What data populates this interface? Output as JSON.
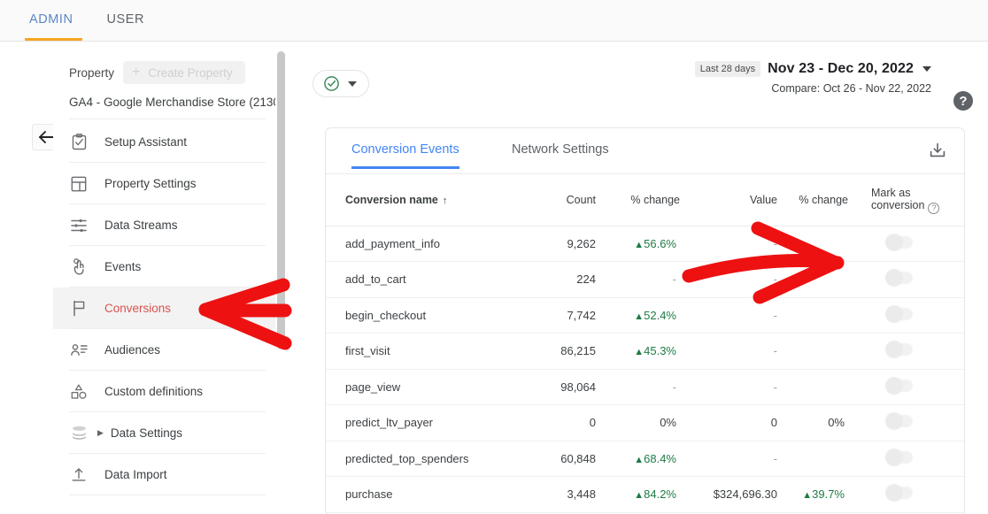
{
  "topbar": {
    "tabs": [
      {
        "label": "ADMIN",
        "active": true
      },
      {
        "label": "USER",
        "active": false
      }
    ]
  },
  "back_button": {
    "icon": "arrow-left-icon"
  },
  "sidebar": {
    "property_label": "Property",
    "create_property_label": "Create Property",
    "property_name": "GA4 - Google Merchandise Store (2130...",
    "items": [
      {
        "label": "Setup Assistant",
        "icon": "clipboard-check-icon",
        "active": false,
        "expandable": false
      },
      {
        "label": "Property Settings",
        "icon": "layout-panel-icon",
        "active": false,
        "expandable": false
      },
      {
        "label": "Data Streams",
        "icon": "sliders-icon",
        "active": false,
        "expandable": false
      },
      {
        "label": "Events",
        "icon": "pointer-hand-icon",
        "active": false,
        "expandable": false
      },
      {
        "label": "Conversions",
        "icon": "flag-icon",
        "active": true,
        "expandable": false
      },
      {
        "label": "Audiences",
        "icon": "person-list-icon",
        "active": false,
        "expandable": false
      },
      {
        "label": "Custom definitions",
        "icon": "shapes-icon",
        "active": false,
        "expandable": false
      },
      {
        "label": "Data Settings",
        "icon": "database-icon",
        "active": false,
        "expandable": true
      },
      {
        "label": "Data Import",
        "icon": "upload-icon",
        "active": false,
        "expandable": false
      }
    ]
  },
  "header": {
    "status_chip_icon": "check-circle-icon",
    "date_pill": "Last 28 days",
    "date_range": "Nov 23 - Dec 20, 2022",
    "compare": "Compare: Oct 26 - Nov 22, 2022",
    "help_icon": "question-mark-icon"
  },
  "card": {
    "tabs": [
      {
        "label": "Conversion Events",
        "active": true
      },
      {
        "label": "Network Settings",
        "active": false
      }
    ],
    "download_icon": "download-icon",
    "columns": {
      "name": "Conversion name",
      "sort_arrow": "↑",
      "count": "Count",
      "count_change": "% change",
      "value": "Value",
      "value_change": "% change",
      "mark": "Mark as conversion",
      "mark_help": "?"
    },
    "rows": [
      {
        "name": "add_payment_info",
        "count": "9,262",
        "count_change": "56.6%",
        "count_dir": "up",
        "value": "-",
        "value_change": "",
        "value_dir": "",
        "toggle": false
      },
      {
        "name": "add_to_cart",
        "count": "224",
        "count_change": "-",
        "count_dir": "none",
        "value": "-",
        "value_change": "",
        "value_dir": "",
        "toggle": false
      },
      {
        "name": "begin_checkout",
        "count": "7,742",
        "count_change": "52.4%",
        "count_dir": "up",
        "value": "-",
        "value_change": "",
        "value_dir": "",
        "toggle": false
      },
      {
        "name": "first_visit",
        "count": "86,215",
        "count_change": "45.3%",
        "count_dir": "up",
        "value": "-",
        "value_change": "",
        "value_dir": "",
        "toggle": false
      },
      {
        "name": "page_view",
        "count": "98,064",
        "count_change": "-",
        "count_dir": "none",
        "value": "-",
        "value_change": "",
        "value_dir": "",
        "toggle": false
      },
      {
        "name": "predict_ltv_payer",
        "count": "0",
        "count_change": "0%",
        "count_dir": "none",
        "value": "0",
        "value_change": "0%",
        "value_dir": "none",
        "toggle": false
      },
      {
        "name": "predicted_top_spenders",
        "count": "60,848",
        "count_change": "68.4%",
        "count_dir": "up",
        "value": "-",
        "value_change": "",
        "value_dir": "",
        "toggle": false
      },
      {
        "name": "purchase",
        "count": "3,448",
        "count_change": "84.2%",
        "count_dir": "up",
        "value": "$324,696.30",
        "value_change": "39.7%",
        "value_dir": "up",
        "toggle": false
      }
    ]
  },
  "annotations": {
    "arrow_left": "red-arrow-pointing-left",
    "arrow_right": "red-arrow-pointing-right",
    "color": "#ee1111"
  },
  "colors": {
    "accent_blue": "#4285f4",
    "tab_underline": "#f5a623",
    "active_nav_text": "#d9534f",
    "positive_green": "#1e7b45",
    "annotation_red": "#ee1111"
  }
}
